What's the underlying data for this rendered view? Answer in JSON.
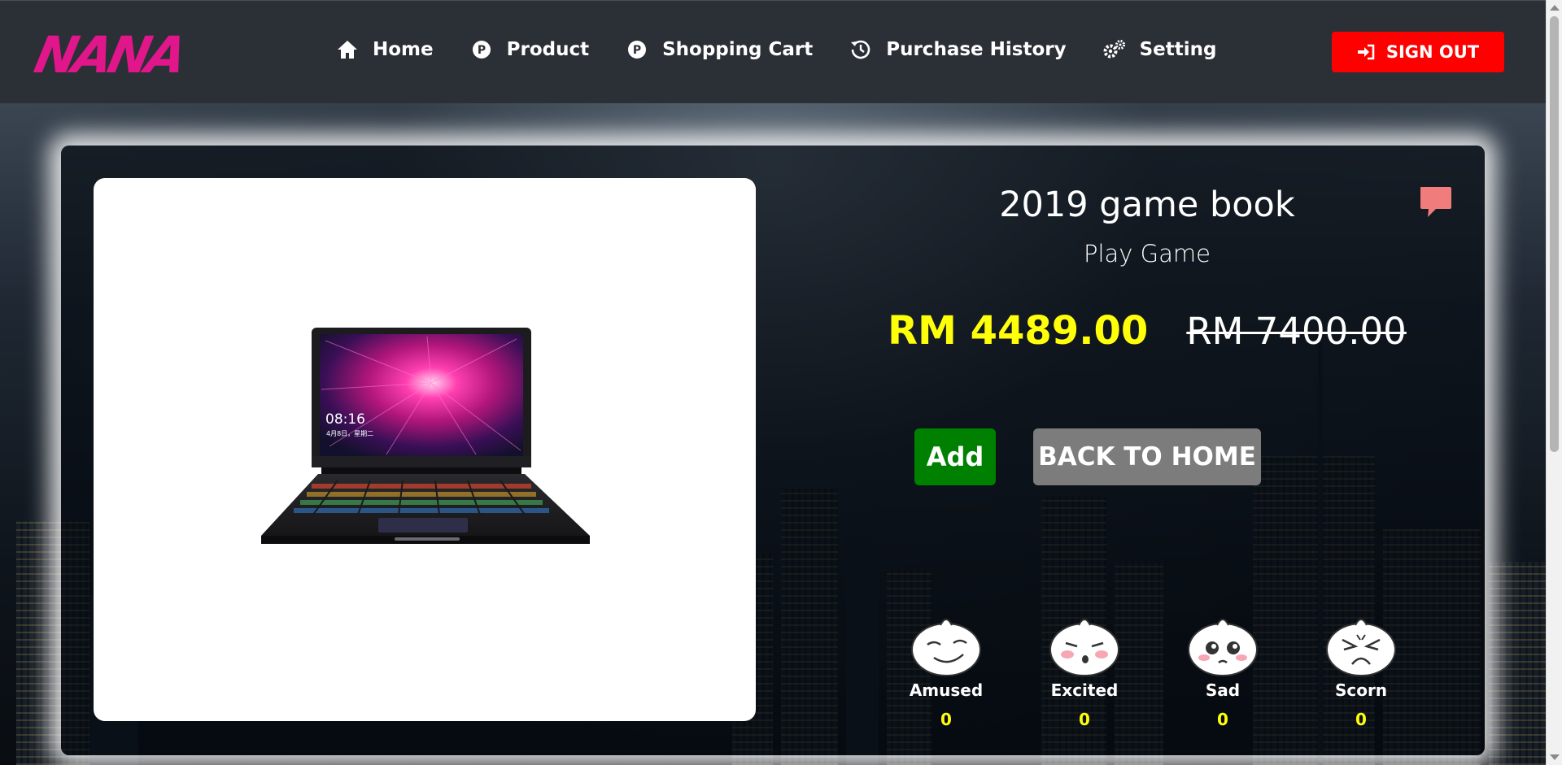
{
  "brand": {
    "logo_text": "NANA",
    "logo_color": "#e0168a"
  },
  "nav": {
    "items": [
      {
        "label": "Home",
        "icon": "home-icon"
      },
      {
        "label": "Product",
        "icon": "product-icon"
      },
      {
        "label": "Shopping Cart",
        "icon": "cart-icon"
      },
      {
        "label": "Purchase History",
        "icon": "history-icon"
      },
      {
        "label": "Setting",
        "icon": "gear-icon"
      }
    ],
    "signout_label": "SIGN OUT",
    "signout_color": "#ff0000"
  },
  "product": {
    "name": "2019 game book",
    "description": "Play Game",
    "price": "RM 4489.00",
    "original_price": "RM 7400.00",
    "image": "laptop-image",
    "laptop_screen_time": "08:16",
    "laptop_screen_date": "4月8日，星期二"
  },
  "actions": {
    "add_label": "Add",
    "back_label": "BACK TO HOME"
  },
  "reactions": [
    {
      "label": "Amused",
      "count": "0"
    },
    {
      "label": "Excited",
      "count": "0"
    },
    {
      "label": "Sad",
      "count": "0"
    },
    {
      "label": "Scorn",
      "count": "0"
    }
  ],
  "colors": {
    "price": "#ffff0a",
    "add": "#008000",
    "back": "#7c7c7c",
    "comment": "#f07c7c"
  }
}
